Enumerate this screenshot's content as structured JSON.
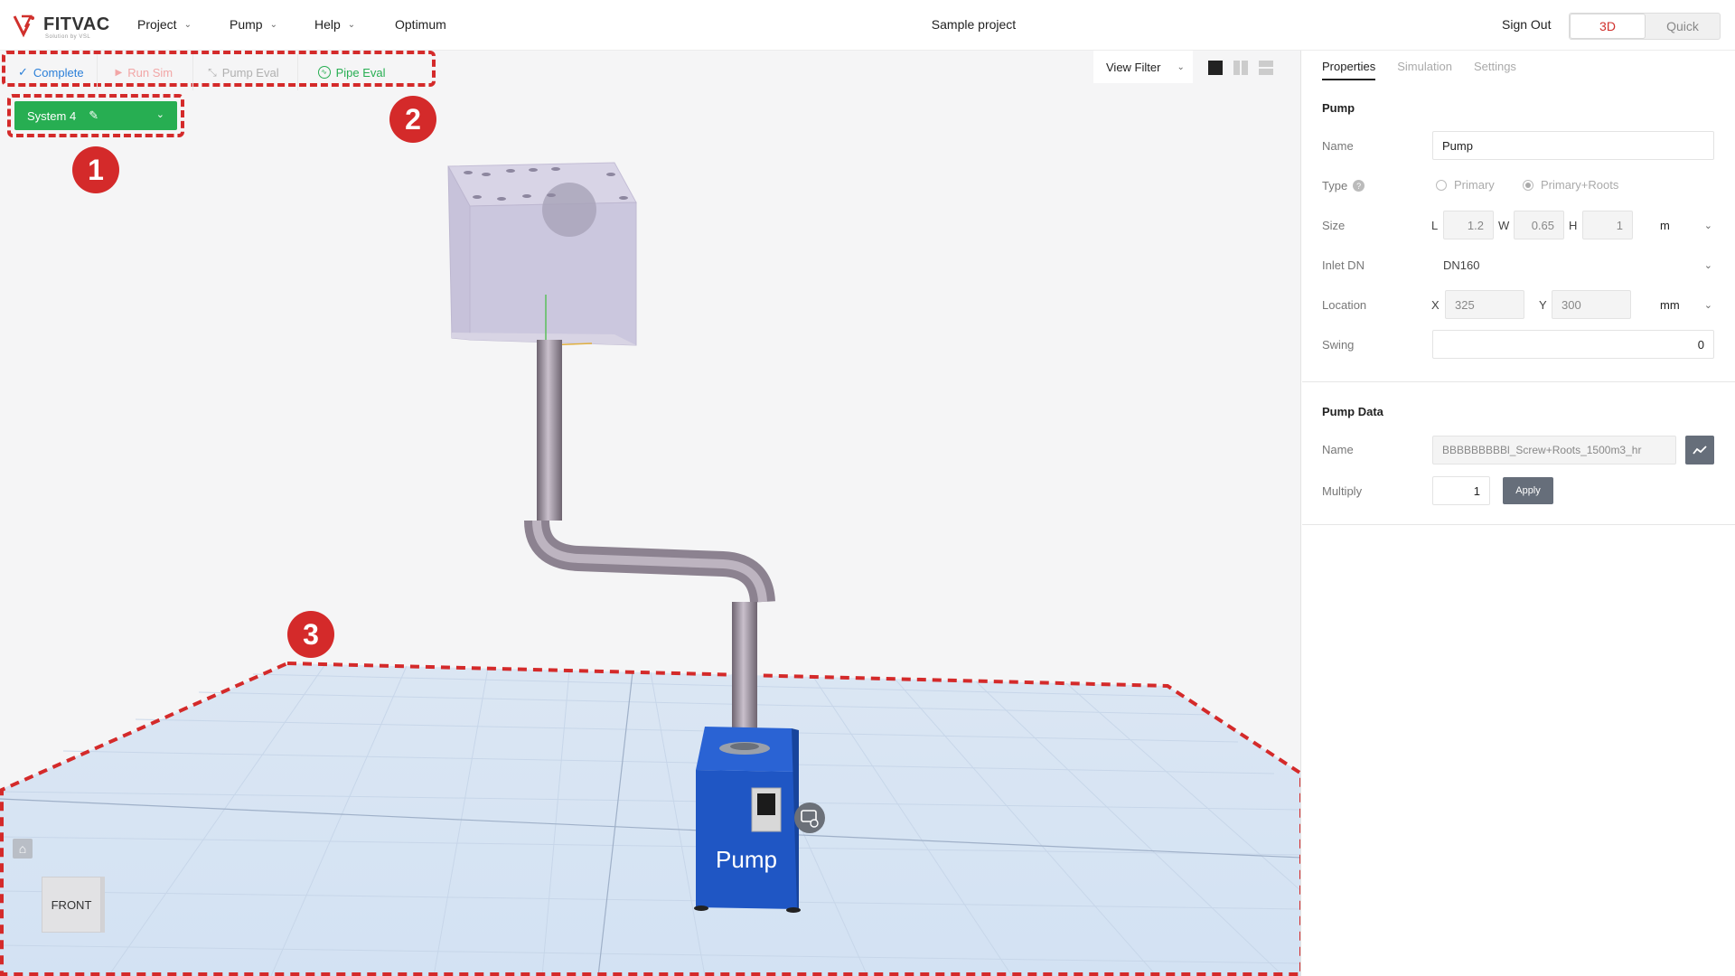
{
  "app": {
    "logo_name": "FITVAC",
    "logo_tagline": "Solution by VSL",
    "project_title": "Sample project"
  },
  "menu": [
    {
      "label": "Project"
    },
    {
      "label": "Pump"
    },
    {
      "label": "Help"
    },
    {
      "label": "Optimum"
    }
  ],
  "header": {
    "sign_out": "Sign Out",
    "mode_3d": "3D",
    "mode_quick": "Quick",
    "active_mode": "3D"
  },
  "toolbar": {
    "complete": "Complete",
    "run_sim": "Run Sim",
    "pump_eval": "Pump Eval",
    "pipe_eval": "Pipe Eval"
  },
  "system": {
    "label": "System 4"
  },
  "view": {
    "filter_label": "View Filter"
  },
  "scene": {
    "pump_label": "Pump",
    "view_cube_face": "FRONT"
  },
  "annotations": [
    "1",
    "2",
    "3"
  ],
  "panel": {
    "tabs": [
      "Properties",
      "Simulation",
      "Settings"
    ],
    "active_tab": "Properties",
    "pump_section": "Pump",
    "name_label": "Name",
    "name_value": "Pump",
    "type_label": "Type",
    "type_options": [
      "Primary",
      "Primary+Roots"
    ],
    "type_selected": "Primary+Roots",
    "size_label": "Size",
    "size_L_label": "L",
    "size_L": "1.2",
    "size_W_label": "W",
    "size_W": "0.65",
    "size_H_label": "H",
    "size_H": "1",
    "size_unit": "m",
    "inlet_label": "Inlet DN",
    "inlet_value": "DN160",
    "location_label": "Location",
    "loc_x_label": "X",
    "loc_x": "325",
    "loc_y_label": "Y",
    "loc_y": "300",
    "loc_unit": "mm",
    "swing_label": "Swing",
    "swing_value": "0",
    "pump_data_section": "Pump Data",
    "data_name_label": "Name",
    "data_name_value": "BBBBBBBBBl_Screw+Roots_1500m3_hr",
    "multiply_label": "Multiply",
    "multiply_value": "1",
    "apply_label": "Apply"
  },
  "colors": {
    "accent_green": "#27ae52",
    "annotation_red": "#d42a2a",
    "pump_blue": "#1f56c4",
    "active_mode_red": "#d0302c"
  }
}
